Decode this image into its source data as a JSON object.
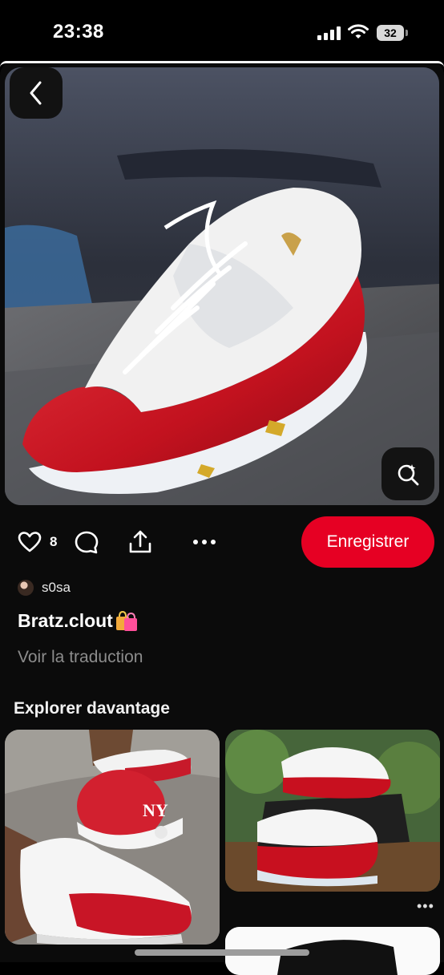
{
  "status_bar": {
    "time": "23:38",
    "battery": "32"
  },
  "pin": {
    "like_count": "8",
    "save_label": "Enregistrer",
    "author": "s0sa",
    "title": "Bratz.clout",
    "translate_label": "Voir la traduction"
  },
  "explore": {
    "heading": "Explorer davantage",
    "more_label": "•••"
  },
  "icons": {
    "back": "chevron-left-icon",
    "lens": "visual-search-icon",
    "like": "heart-icon",
    "comment": "comment-bubble-icon",
    "share": "share-icon",
    "more": "more-horizontal-icon",
    "title_emoji": "shopping-bags-emoji"
  },
  "colors": {
    "accent": "#e60023",
    "background": "#000000",
    "muted_text": "#8c8c8c"
  }
}
